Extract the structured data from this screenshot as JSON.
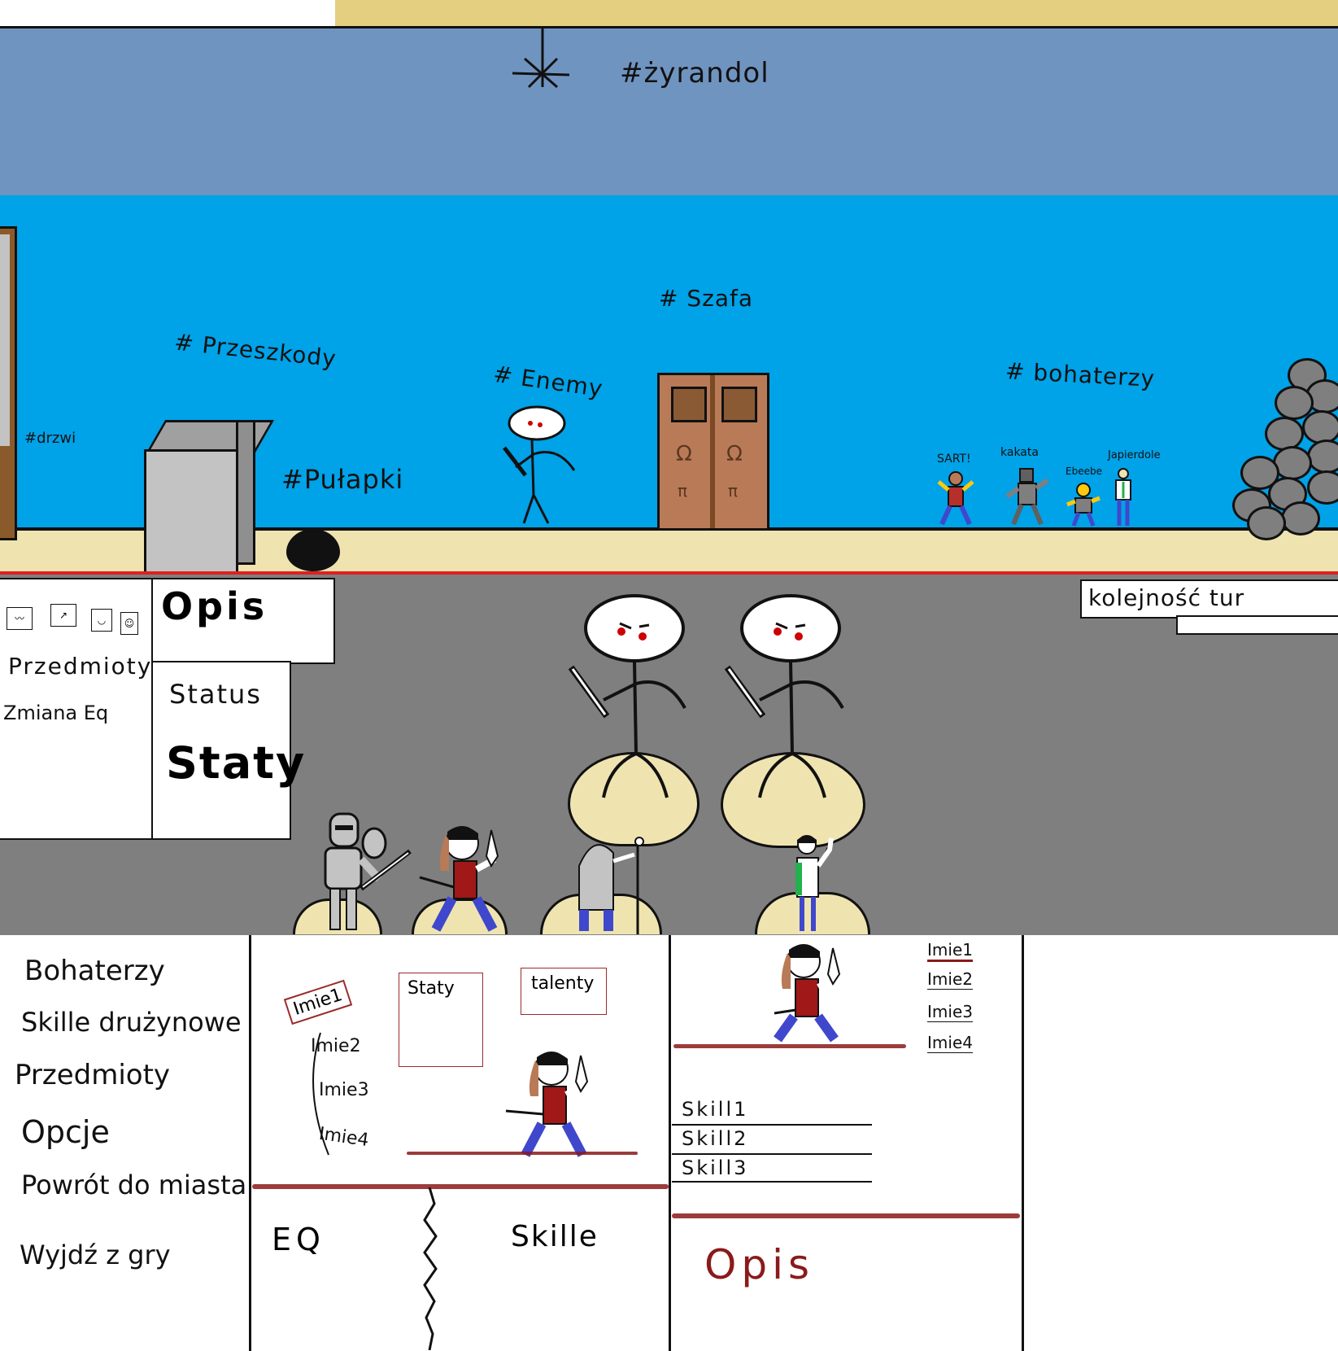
{
  "scene": {
    "labels": {
      "chandelier": "#żyrandol",
      "wardrobe": "# Szafa",
      "obstacles": "# Przeszkody",
      "enemy": "# Enemy",
      "heroes": "# bohaterzy",
      "doors": "#drzwi",
      "traps": "#Pułapki"
    },
    "heroes": [
      {
        "name": "SART!",
        "color": "#b5302b"
      },
      {
        "name": "kakata",
        "color": "#7f7f7f"
      },
      {
        "name": "Ebeebe",
        "color": "#3f48cc"
      },
      {
        "name": "Japierdole",
        "color": "#ffffff"
      }
    ]
  },
  "battle": {
    "menu_icons": [
      "scroll-icon",
      "arrow-icon",
      "shield-icon",
      "face-icon"
    ],
    "left_menu": {
      "items": "Przedmioty",
      "change_eq": "Zmiana Eq"
    },
    "opis": "Opis",
    "status": "Status",
    "staty": "Staty",
    "turn_order": "kolejność tur"
  },
  "menu": {
    "main": [
      "Bohaterzy",
      "Skille drużynowe",
      "Przedmioty",
      "Opcje",
      "Powrót do miasta",
      "Wyjdź z gry"
    ],
    "hero_tabs": [
      "Imie1",
      "Imie2",
      "Imie3",
      "Imie4"
    ],
    "staty_box": "Staty",
    "talenty_box": "talenty",
    "eq": "EQ",
    "skille": "Skille",
    "team_names": [
      "Imie1",
      "Imie2",
      "Imie3",
      "Imie4"
    ],
    "skills": [
      "Skill1",
      "Skill2",
      "Skill3"
    ],
    "opis": "Opis",
    "accent_red": "#8b1a1a"
  }
}
